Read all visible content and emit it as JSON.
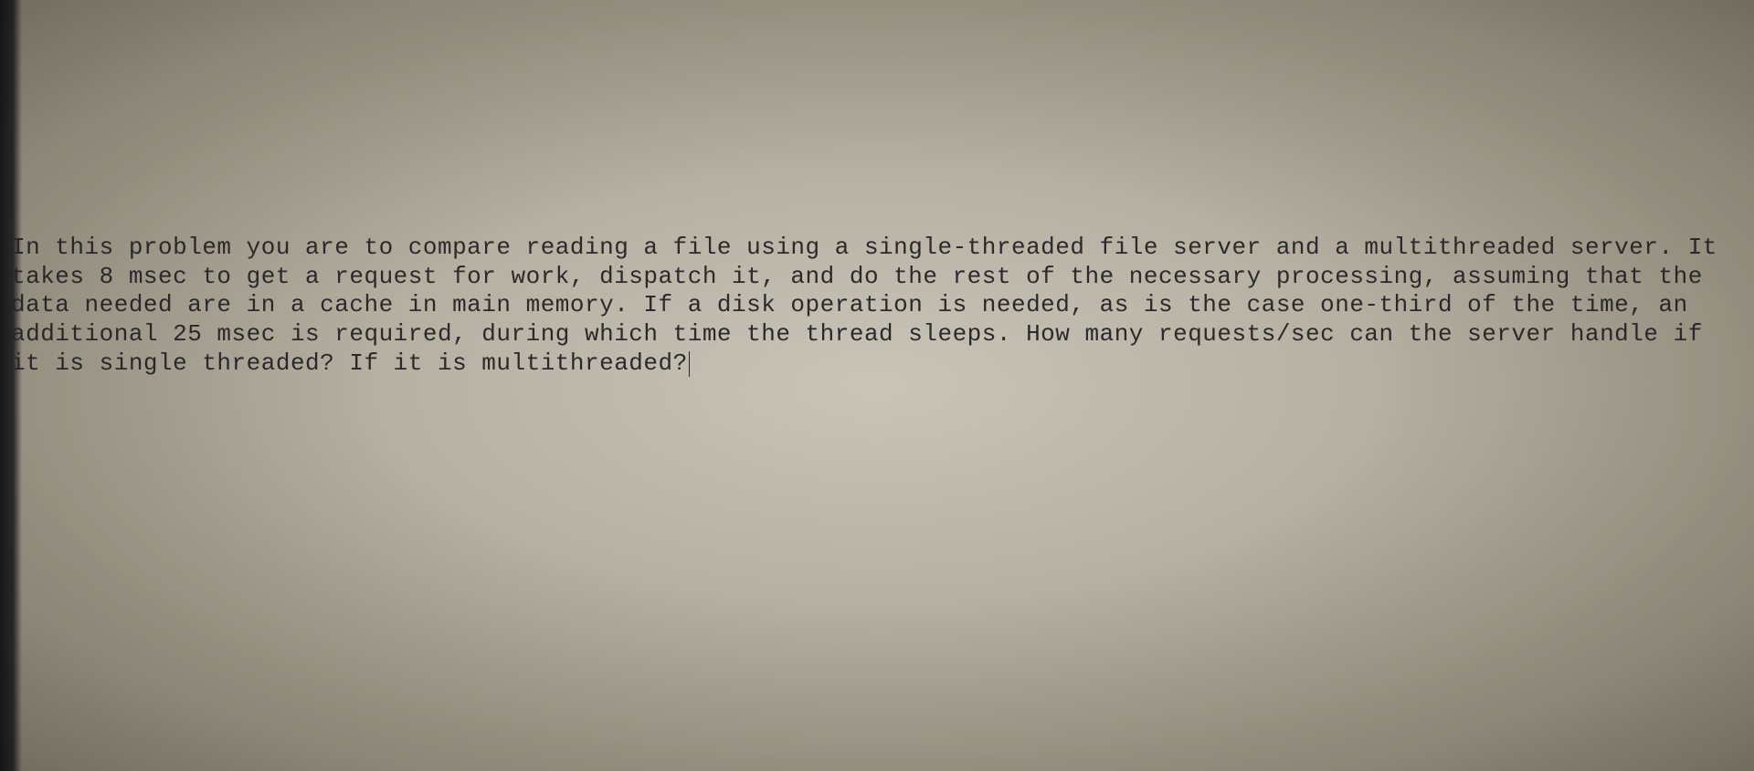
{
  "problem": {
    "text": "In this problem you are to compare reading a file using a single-threaded file server and a multithreaded server. It takes 8 msec to get a request for work, dispatch it, and do the rest of the necessary processing, assuming that the data needed are in a cache in main memory. If a disk operation is needed, as is the case one-third of the time, an additional 25 msec is required, during which time the thread sleeps. How many requests/sec can the server handle if it is single threaded? If it is multithreaded?"
  }
}
